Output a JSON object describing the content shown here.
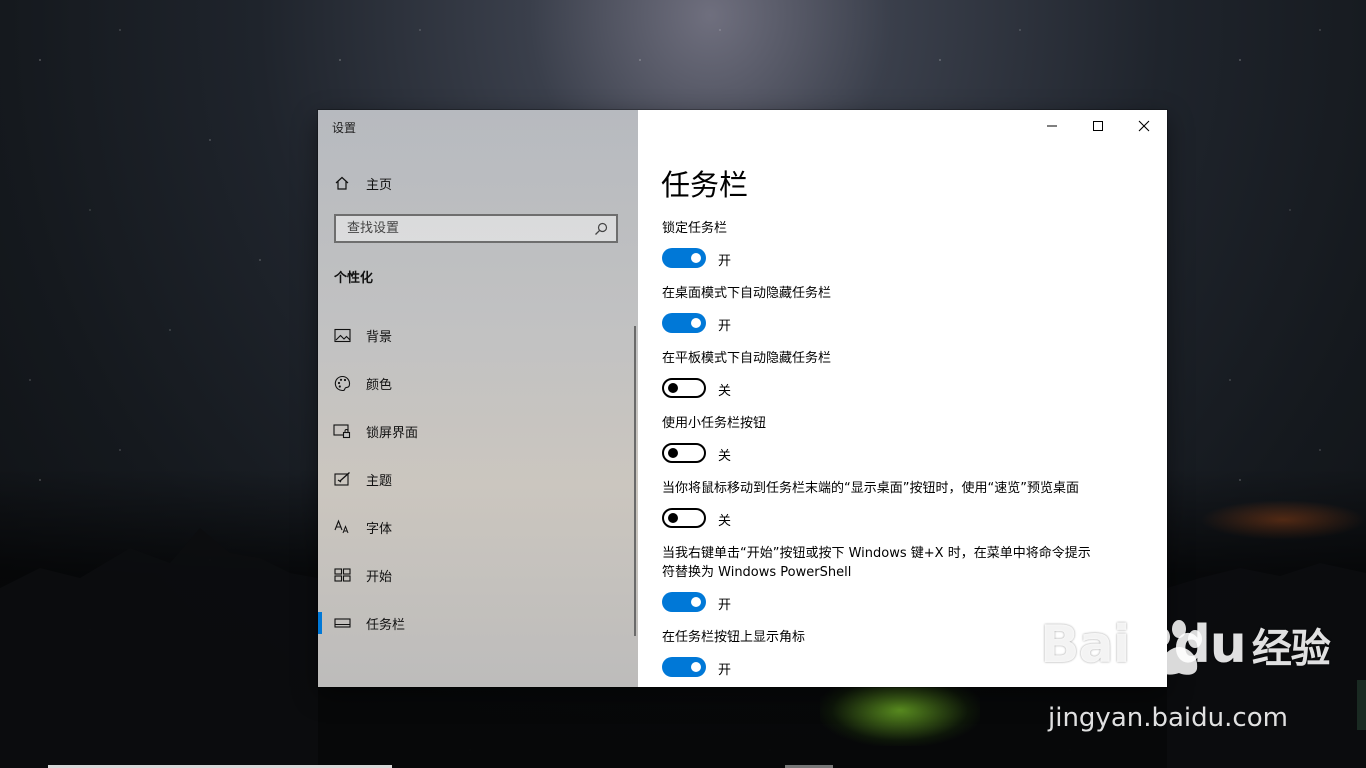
{
  "window": {
    "app_title": "设置",
    "controls": {
      "minimize": "minimize-icon",
      "maximize": "maximize-icon",
      "close": "close-icon"
    }
  },
  "sidebar": {
    "home_label": "主页",
    "search_placeholder": "查找设置",
    "section_title": "个性化",
    "items": [
      {
        "label": "背景",
        "icon": "picture-icon"
      },
      {
        "label": "颜色",
        "icon": "palette-icon"
      },
      {
        "label": "锁屏界面",
        "icon": "lock-screen-icon"
      },
      {
        "label": "主题",
        "icon": "theme-icon"
      },
      {
        "label": "字体",
        "icon": "font-icon"
      },
      {
        "label": "开始",
        "icon": "start-icon"
      },
      {
        "label": "任务栏",
        "icon": "taskbar-icon",
        "active": true
      }
    ]
  },
  "main": {
    "title": "任务栏",
    "settings": [
      {
        "label": "锁定任务栏",
        "on": true,
        "state_text": "开"
      },
      {
        "label": "在桌面模式下自动隐藏任务栏",
        "on": true,
        "state_text": "开"
      },
      {
        "label": "在平板模式下自动隐藏任务栏",
        "on": false,
        "state_text": "关"
      },
      {
        "label": "使用小任务栏按钮",
        "on": false,
        "state_text": "关"
      },
      {
        "label": "当你将鼠标移动到任务栏末端的“显示桌面”按钮时，使用“速览”预览桌面",
        "on": false,
        "state_text": "关"
      },
      {
        "label": "当我右键单击“开始”按钮或按下 Windows 键+X 时，在菜单中将命令提示符替换为 Windows PowerShell",
        "on": true,
        "state_text": "开"
      },
      {
        "label": "在任务栏按钮上显示角标",
        "on": true,
        "state_text": "开"
      }
    ]
  },
  "watermark": {
    "logo_text": "Bai",
    "logo_text2": "du",
    "logo_cn": "经验",
    "url": "jingyan.baidu.com"
  },
  "colors": {
    "accent": "#0078d7"
  }
}
